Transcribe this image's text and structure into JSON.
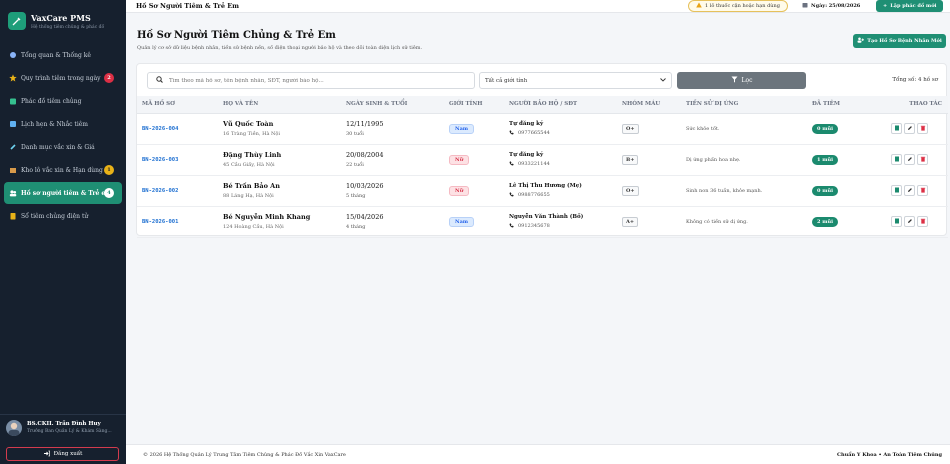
{
  "brand": {
    "title": "VaxCare PMS",
    "subtitle": "Hệ thống tiêm chủng & phác đồ"
  },
  "sidebar": {
    "items": [
      {
        "label": "Tổng quan & Thống kê",
        "icon": "dashboard-icon",
        "color": "#8ab4f8"
      },
      {
        "label": "Quy trình tiêm trong ngày",
        "icon": "star-icon",
        "color": "#e8b218",
        "badge": "2"
      },
      {
        "label": "Phác đồ tiêm chủng",
        "icon": "calendar-icon",
        "color": "#35c08f"
      },
      {
        "label": "Lịch hẹn & Nhắc tiêm",
        "icon": "bell-icon",
        "color": "#5fb0f0"
      },
      {
        "label": "Danh mục vắc xin & Giá",
        "icon": "vial-icon",
        "color": "#6ed3f0"
      },
      {
        "label": "Kho lô vắc xin & Hạn dùng",
        "icon": "box-icon",
        "color": "#d89a4a",
        "badge": "1"
      },
      {
        "label": "Hồ sơ người tiêm & Trẻ em",
        "icon": "users-icon",
        "color": "#ffffff",
        "badge": "4"
      },
      {
        "label": "Sổ tiêm chủng điện tử",
        "icon": "book-icon",
        "color": "#e8b218"
      }
    ]
  },
  "user": {
    "name": "BS.CKII. Trần Đình Huy",
    "role": "Trưởng Ban Quản Lý & Khám Sàng..."
  },
  "logout_label": "Đăng xuất",
  "topbar": {
    "title": "Hồ Sơ Người Tiêm & Trẻ Em",
    "alert": "1 lô thuốc cận hoặc hạn dùng",
    "date": "Ngày: 25/08/2026",
    "new_button": "Lập phác đồ mới"
  },
  "page": {
    "title": "Hồ Sơ Người Tiêm Chủng & Trẻ Em",
    "description": "Quản lý cơ sở dữ liệu bệnh nhân, tiền sử bệnh nền, số điện thoại người bảo hộ và theo dõi toàn diện lịch sử tiêm.",
    "add_button": "Tạo Hồ Sơ Bệnh Nhân Mới"
  },
  "filters": {
    "search_placeholder": "Tìm theo mã hồ sơ, tên bệnh nhân, SĐT, người bảo hộ...",
    "gender_select": "Tất cả giới tính",
    "filter_button": "Lọc",
    "total": "Tổng số: 4 hồ sơ"
  },
  "table": {
    "headers": [
      "MÃ HỒ SƠ",
      "HỌ VÀ TÊN",
      "NGÀY SINH & TUỔI",
      "GIỚI TÍNH",
      "NGƯỜI BẢO HỘ / SĐT",
      "NHÓM MÁU",
      "TIỀN SỬ DỊ ỨNG",
      "ĐÃ TIÊM",
      "THAO TÁC"
    ],
    "rows": [
      {
        "code": "BN-2026-004",
        "name": "Vũ Quốc Toàn",
        "address": "16 Tràng Tiền, Hà Nội",
        "dob": "12/11/1995",
        "age": "30 tuổi",
        "gender": "Nam",
        "guardian": "Tự đăng ký",
        "phone": "0977665544",
        "blood": "O+",
        "history": "Sức khỏe tốt.",
        "doses": "0 mũi"
      },
      {
        "code": "BN-2026-003",
        "name": "Đặng Thùy Linh",
        "address": "45 Cầu Giấy, Hà Nội",
        "dob": "20/08/2004",
        "age": "22 tuổi",
        "gender": "Nữ",
        "guardian": "Tự đăng ký",
        "phone": "0933221144",
        "blood": "B+",
        "history": "Dị ứng phấn hoa nhẹ.",
        "doses": "1 mũi"
      },
      {
        "code": "BN-2026-002",
        "name": "Bé Trần Bảo An",
        "address": "88 Láng Hạ, Hà Nội",
        "dob": "10/03/2026",
        "age": "5 tháng",
        "gender": "Nữ",
        "guardian": "Lê Thị Thu Hương (Mẹ)",
        "phone": "0988776655",
        "blood": "O+",
        "history": "Sinh non 36 tuần, khỏe mạnh.",
        "doses": "0 mũi"
      },
      {
        "code": "BN-2026-001",
        "name": "Bé Nguyễn Minh Khang",
        "address": "124 Hoàng Cầu, Hà Nội",
        "dob": "15/04/2026",
        "age": "4 tháng",
        "gender": "Nam",
        "guardian": "Nguyễn Văn Thành (Bố)",
        "phone": "0912345678",
        "blood": "A+",
        "history": "Không có tiền sử dị ứng.",
        "doses": "2 mũi"
      }
    ]
  },
  "footer": {
    "left": "© 2026 Hệ Thống Quản Lý Trung Tâm Tiêm Chủng & Phác Đồ Vắc Xin VaxCare",
    "right": "Chuẩn Y Khoa • An Toàn Tiêm Chủng"
  },
  "colors": {
    "sidebar_bg": "#16202e",
    "accent": "#1f8f74",
    "danger": "#dc2f45",
    "code_blue": "#1d6fd1"
  }
}
